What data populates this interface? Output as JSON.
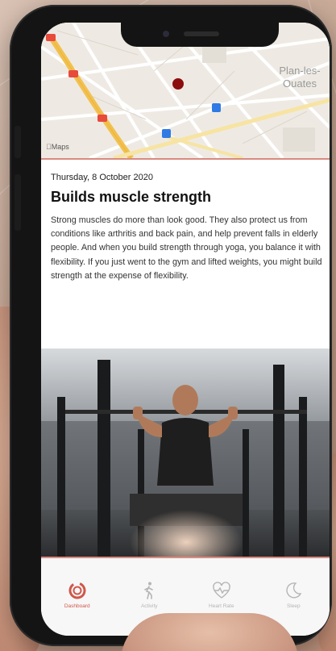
{
  "map": {
    "place_label": "Plan-les-Ouates",
    "logo_text": "Maps",
    "colors": {
      "pin": "#8b0d0d",
      "road_highway": "#f2c14e",
      "marker_red": "#e64b3c",
      "marker_blue": "#2f7ae5"
    }
  },
  "article": {
    "date": "Thursday, 8 October 2020",
    "title": "Builds muscle strength",
    "body": "Strong muscles do more than look good. They also protect us from conditions like arthritis and back pain, and help prevent falls in elderly people. And when you build strength through yoga, you balance it with flexibility. If you just went to the gym and lifted weights, you might build strength at the expense of flexibility."
  },
  "photo": {
    "description_icon": "weightlifting-photo"
  },
  "tabbar": {
    "accent": "#d0574c",
    "inactive": "#b5b5b5",
    "tabs": [
      {
        "label": "Dashboard",
        "icon": "dashboard-ring-icon",
        "active": true
      },
      {
        "label": "Activity",
        "icon": "walking-person-icon",
        "active": false
      },
      {
        "label": "Heart Rate",
        "icon": "heart-pulse-icon",
        "active": false
      },
      {
        "label": "Sleep",
        "icon": "moon-icon",
        "active": false
      }
    ]
  }
}
